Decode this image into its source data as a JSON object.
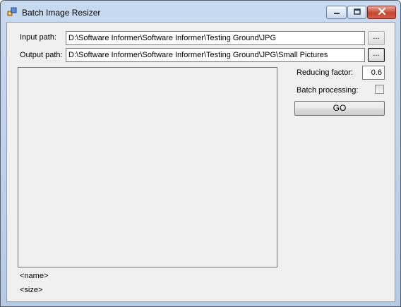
{
  "window": {
    "title": "Batch Image Resizer",
    "icon": "app-image-icon"
  },
  "caption_buttons": {
    "minimize_icon": "minimize-icon",
    "maximize_icon": "maximize-icon",
    "close_icon": "close-icon"
  },
  "paths": {
    "input_label": "Input path:",
    "input_value": "D:\\Software Informer\\Software Informer\\Testing Ground\\JPG",
    "input_browse_label": "...",
    "output_label": "Output path:",
    "output_value": "D:\\Software Informer\\Software Informer\\Testing Ground\\JPG\\Small Pictures",
    "output_browse_label": "..."
  },
  "options": {
    "reducing_factor_label": "Reducing factor:",
    "reducing_factor_value": "0.6",
    "batch_label": "Batch processing:",
    "batch_checked": false,
    "go_label": "GO"
  },
  "image_info": {
    "name": "<name>",
    "size": "<size>"
  },
  "colors": {
    "client_background": "#f0f0f0",
    "titlebar": "#c8daf0",
    "close_button": "#c8442f"
  }
}
